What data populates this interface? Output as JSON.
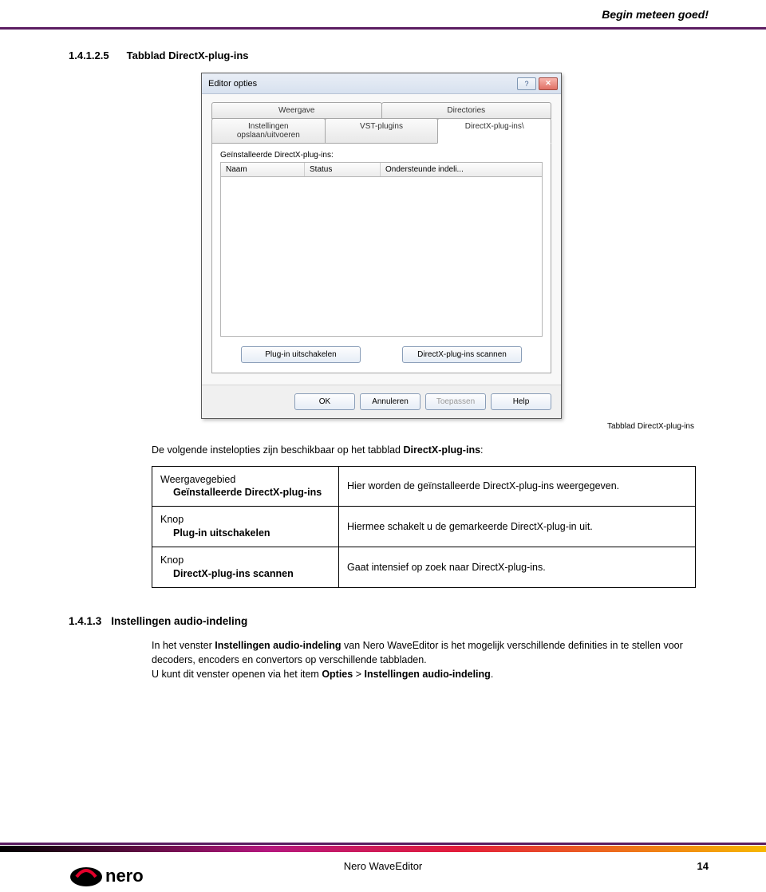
{
  "header": {
    "right_text": "Begin meteen goed!"
  },
  "section1": {
    "number": "1.4.1.2.5",
    "title": "Tabblad DirectX-plug-ins"
  },
  "dialog": {
    "title": "Editor opties",
    "help_icon": "?",
    "close_icon": "✕",
    "tabs_row1": [
      "Weergave",
      "Directories"
    ],
    "tabs_row2": [
      "Instellingen opslaan/uitvoeren",
      "VST-plugins",
      "DirectX-plug-ins\\"
    ],
    "panel_label": "Geïnstalleerde DirectX-plug-ins:",
    "columns": {
      "name": "Naam",
      "status": "Status",
      "supported": "Ondersteunde indeli..."
    },
    "panel_buttons": {
      "disable": "Plug-in uitschakelen",
      "scan": "DirectX-plug-ins scannen"
    },
    "footer_buttons": {
      "ok": "OK",
      "cancel": "Annuleren",
      "apply": "Toepassen",
      "help": "Help"
    }
  },
  "caption": "Tabblad DirectX-plug-ins",
  "intro": {
    "prefix": "De volgende instelopties zijn beschikbaar op het tabblad ",
    "bold": "DirectX-plug-ins",
    "suffix": ":"
  },
  "deftable": {
    "row1_left_label": "Weergavegebied",
    "row1_left_bold": "Geïnstalleerde DirectX-plug-ins",
    "row1_right": "Hier worden de geïnstalleerde DirectX-plug-ins weergegeven.",
    "row2_left_label": "Knop",
    "row2_left_bold": "Plug-in uitschakelen",
    "row2_right": "Hiermee schakelt u de gemarkeerde DirectX-plug-in uit.",
    "row3_left_label": "Knop",
    "row3_left_bold": "DirectX-plug-ins scannen",
    "row3_right": "Gaat intensief op zoek naar DirectX-plug-ins."
  },
  "section2": {
    "number": "1.4.1.3",
    "title": "Instellingen audio-indeling",
    "p1_a": "In het venster ",
    "p1_bold": "Instellingen audio-indeling",
    "p1_b": " van Nero WaveEditor is het mogelijk verschillende definities in te stellen voor decoders, encoders en convertors op verschillende tabbladen.",
    "p2_a": "U kunt dit venster openen via het item ",
    "p2_bold1": "Opties",
    "p2_mid": " > ",
    "p2_bold2": "Instellingen audio-indeling",
    "p2_end": "."
  },
  "footer": {
    "center": "Nero WaveEditor",
    "page": "14"
  }
}
